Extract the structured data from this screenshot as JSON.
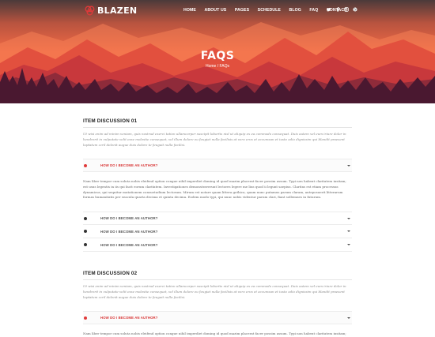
{
  "brand": {
    "name": "BLAZEN"
  },
  "nav": {
    "items": [
      "HOME",
      "ABOUT US",
      "PAGES",
      "SCHEDULE",
      "BLOG",
      "FAQ",
      "CONTACT"
    ]
  },
  "social": [
    "twitter-icon",
    "facebook-icon",
    "instagram-icon",
    "dribbble-icon"
  ],
  "hero": {
    "title": "FAQS",
    "breadcrumb_home": "Home",
    "breadcrumb_sep": " / ",
    "breadcrumb_current": "FAQs"
  },
  "colors": {
    "accent": "#e03a3a",
    "hero_sky": "#f2603f",
    "hero_dark": "#4a1830"
  },
  "sections": [
    {
      "title": "ITEM DISCUSSION 01",
      "description": "Ut wisi enim ad minim veniam, quis nostrud exerci tation ullamcorper suscipit lobortis nisl ut aliquip ex ea commodo consequat. Duis autem vel eum iriure dolor in hendrerit in vulputate velit esse molestie consequat, vel illum dolore eu feugiat nulla facilisis at vero eros et accumsan et iusto odio dignissim qui blandit praesent luptatum zzril delenit augue duis dolore te feugait nulla facilisi.",
      "accordion": [
        {
          "label": "HOW DO I BECOME AN AUTHOR?",
          "open": true,
          "answer": "Nam liber tempor cum soluta nobis eleifend option congue nihil imperdiet doming id quod mazim placerat facer possim assum. Typi non habent claritatem insitam; est usus legentis in iis qui facit eorum claritatem. Investigationes demonstraverunt lectores legere me lius quod ii legunt saepius. Claritas est etiam processus dynamicus, qui sequitur mutationem consuetudium lectorum. Mirum est notare quam littera gothica, quam nunc putamus parum claram, anteposuerit litterarum formas humanitatis per seacula quarta decima et quinta decima. Eodem modo typi, qui nunc nobis videntur parum clari, fiant sollemnes in futurum."
        },
        {
          "label": "HOW DO I BECOME AN AUTHOR?",
          "open": false
        },
        {
          "label": "HOW DO I BECOME AN AUTHOR?",
          "open": false
        },
        {
          "label": "HOW DO I BECOME AN AUTHOR?",
          "open": false
        }
      ]
    },
    {
      "title": "ITEM DISCUSSION 02",
      "description": "Ut wisi enim ad minim veniam, quis nostrud exerci tation ullamcorper suscipit lobortis nisl ut aliquip ex ea commodo consequat. Duis autem vel eum iriure dolor in hendrerit in vulputate velit esse molestie consequat, vel illum dolore eu feugiat nulla facilisis at vero eros et accumsan et iusto odio dignissim qui blandit praesent luptatum zzril delenit augue duis dolore te feugait nulla facilisi.",
      "accordion": [
        {
          "label": "HOW DO I BECOME AN AUTHOR?",
          "open": true,
          "answer": "Nam liber tempor cum soluta nobis eleifend option congue nihil imperdiet doming id quod mazim placerat facer possim assum. Typi non habent claritatem insitam; est"
        }
      ]
    }
  ]
}
